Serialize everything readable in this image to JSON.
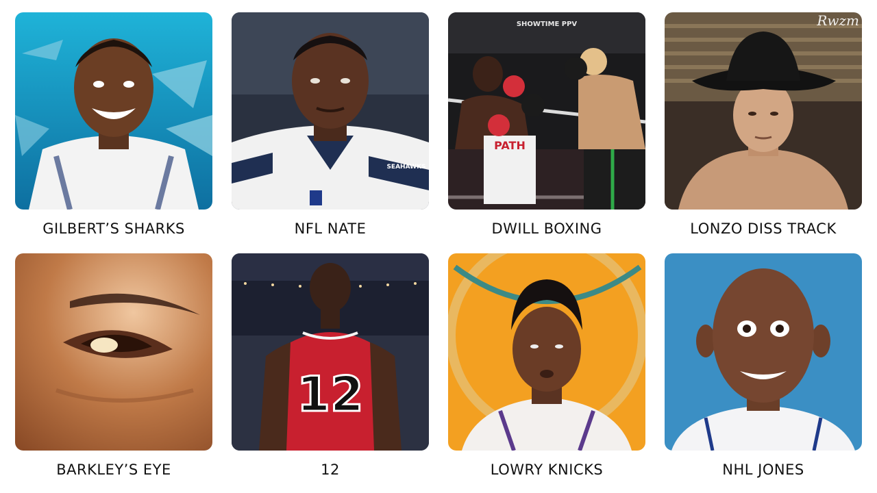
{
  "watermark": "Rwzm",
  "tiles": [
    {
      "caption": "GILBERT’S SHARKS",
      "jersey_text": ""
    },
    {
      "caption": "NFL NATE",
      "jersey_text": "SEAHAWKS"
    },
    {
      "caption": "DWILL BOXING",
      "jersey_text": "PATH",
      "banner_text": "SHOWTIME PPV"
    },
    {
      "caption": "LONZO DISS TRACK",
      "jersey_text": ""
    },
    {
      "caption": "BARKLEY’S EYE",
      "jersey_text": ""
    },
    {
      "caption": "12",
      "jersey_text": "12"
    },
    {
      "caption": "LOWRY KNICKS",
      "jersey_text": ""
    },
    {
      "caption": "NHL JONES",
      "jersey_text": ""
    }
  ],
  "colors": {
    "background": "#ffffff",
    "caption_text": "#111111",
    "shark_water": "#2aa7d6",
    "seahawks_navy": "#1f2f52",
    "bulls_red": "#c8202f",
    "suns_orange": "#f3a021",
    "photo_blue": "#3b8fc4"
  }
}
